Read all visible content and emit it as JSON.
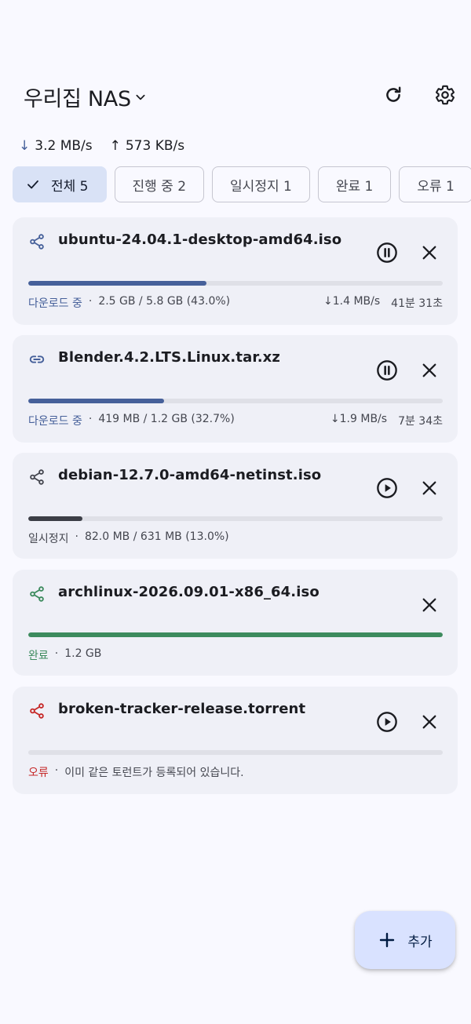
{
  "header": {
    "title": "우리집 NAS",
    "refresh_icon": "refresh-icon",
    "settings_icon": "gear-icon"
  },
  "speed": {
    "down_arrow": "↓",
    "down": "3.2 MB/s",
    "up_arrow": "↑",
    "up": "573 KB/s"
  },
  "filters": [
    {
      "label": "전체 5",
      "selected": true
    },
    {
      "label": "진행 중 2",
      "selected": false
    },
    {
      "label": "일시정지 1",
      "selected": false
    },
    {
      "label": "완료 1",
      "selected": false
    },
    {
      "label": "오류 1",
      "selected": false
    }
  ],
  "colors": {
    "accent": "#46609a",
    "paused": "#44464f",
    "success": "#3d8b5e",
    "error": "#c62828",
    "downloading_status": "#46609a"
  },
  "torrents": [
    {
      "name": "ubuntu-24.04.1-desktop-amd64.iso",
      "kind_icon": "share-icon",
      "status": "다운로드 중",
      "sep": "·",
      "size": "2.5 GB / 5.8 GB (43.0%)",
      "rate": "↓1.4 MB/s",
      "eta": "41분 31초",
      "progress": 0.43,
      "action_icon": "pause-icon"
    },
    {
      "name": "Blender.4.2.LTS.Linux.tar.xz",
      "kind_icon": "link-icon",
      "status": "다운로드 중",
      "sep": "·",
      "size": "419 MB / 1.2 GB (32.7%)",
      "rate": "↓1.9 MB/s",
      "eta": "7분 34초",
      "progress": 0.327,
      "action_icon": "pause-icon"
    },
    {
      "name": "debian-12.7.0-amd64-netinst.iso",
      "kind_icon": "share-icon",
      "status": "일시정지",
      "sep": "·",
      "size": "82.0 MB / 631 MB (13.0%)",
      "progress": 0.13,
      "action_icon": "play-icon"
    },
    {
      "name": "archlinux-2026.09.01-x86_64.iso",
      "kind_icon": "share-icon",
      "status": "완료",
      "sep": "·",
      "size": "1.2 GB",
      "progress": 1.0
    },
    {
      "name": "broken-tracker-release.torrent",
      "kind_icon": "share-icon",
      "status": "오류",
      "sep": "·",
      "size": "이미 같은 토런트가 등록되어 있습니다.",
      "progress": 0,
      "action_icon": "play-icon"
    }
  ],
  "fab": {
    "label": "추가",
    "icon": "plus-icon"
  }
}
